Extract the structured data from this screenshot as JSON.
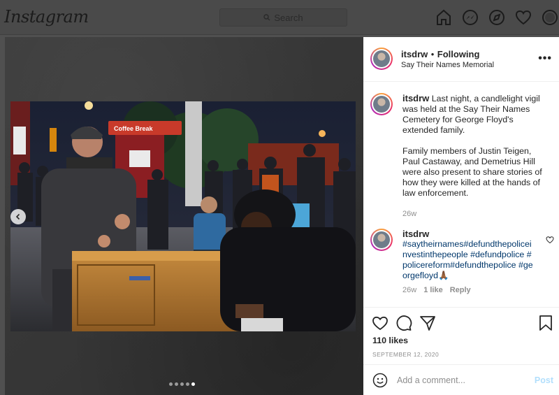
{
  "nav": {
    "logo": "Instagram",
    "search_placeholder": "Search",
    "icons": [
      "home-icon",
      "messenger-icon",
      "explore-icon",
      "activity-heart-icon",
      "profile-icon"
    ]
  },
  "media": {
    "carousel_dots": 5,
    "active_dot_index": 4,
    "photo_signs": {
      "coffee_sign": "Coffee Break"
    }
  },
  "post": {
    "username": "itsdrw",
    "follow_sep": "•",
    "follow_status": "Following",
    "location": "Say Their Names Memorial",
    "more": "•••",
    "caption_user": "itsdrw",
    "caption_p1": "Last night, a candlelight vigil was held at the Say Their Names Cemetery for George Floyd's extended family.",
    "caption_p2": "Family members of Justin Teigen, Paul Castaway, and Demetrius Hill were also present to share stories of how they were killed at the hands of law enforcement.",
    "caption_age": "26w"
  },
  "comment": {
    "username": "itsdrw",
    "hashtags": "#saytheirnames#defundthepoliceinvestinthepeople #defundpolice #policereform#defundthepolice #georgefloyd",
    "emoji": "🙏🏾",
    "age": "26w",
    "likes": "1 like",
    "reply": "Reply"
  },
  "actions": {
    "likes": "110 likes",
    "date": "SEPTEMBER 12, 2020",
    "add_comment_placeholder": "Add a comment...",
    "post_label": "Post"
  },
  "colors": {
    "accent_link": "#00376b",
    "post_disabled": "#b2dffc",
    "meta_gray": "#8e8e8e",
    "overlay": "#505050"
  }
}
